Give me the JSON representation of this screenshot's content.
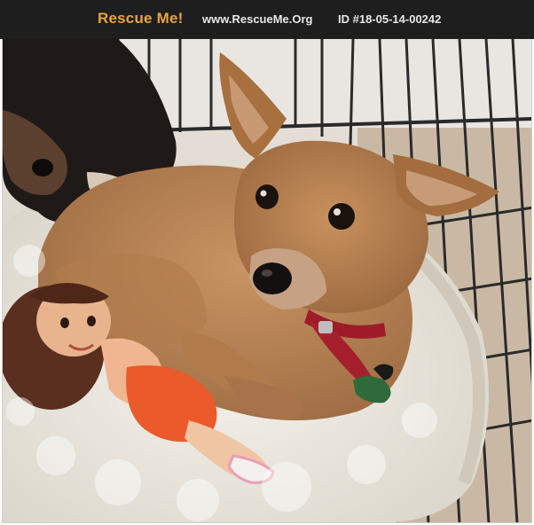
{
  "header": {
    "brand": "Rescue Me!",
    "site": "www.RescueMe.Org",
    "id_text": "ID #18-05-14-00242"
  },
  "colors": {
    "header_bg": "#1e1e1e",
    "brand": "#e8a43c",
    "header_text": "#e7e7e7"
  },
  "photo": {
    "subject": "small tan chihuahua-mix dog lying on a white fluffy bed inside a wire crate, next to a plush doll toy and a black dog"
  }
}
